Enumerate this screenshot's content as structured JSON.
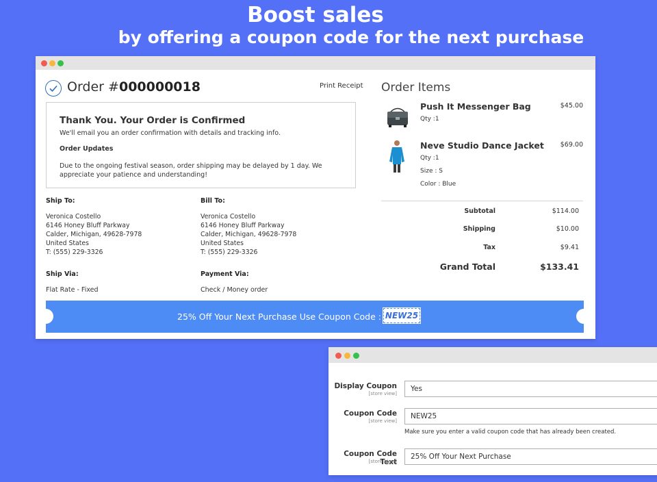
{
  "headline": {
    "title": "Boost sales",
    "subtitle": "by offering a coupon code for the next purchase"
  },
  "order": {
    "title_prefix": "Order #",
    "number": "000000018",
    "print_link": "Print Receipt",
    "confirmation": {
      "title": "Thank You. Your Order is Confirmed",
      "text": "We'll email you an order confirmation with details and tracking info.",
      "updates_label": "Order Updates",
      "updates_text": "Due to the ongoing festival season, order shipping may be delayed by 1 day. We appreciate your patience and understanding!"
    },
    "ship_to": {
      "label": "Ship To:",
      "name": "Veronica Costello",
      "street": "6146 Honey Bluff Parkway",
      "city": "Calder, Michigan, 49628-7978",
      "country": "United States",
      "phone": "T: (555) 229-3326"
    },
    "bill_to": {
      "label": "Bill To:",
      "name": "Veronica Costello",
      "street": "6146 Honey Bluff Parkway",
      "city": "Calder, Michigan, 49628-7978",
      "country": "United States",
      "phone": "T: (555) 229-3326"
    },
    "ship_via": {
      "label": "Ship Via:",
      "value": "Flat Rate - Fixed"
    },
    "payment_via": {
      "label": "Payment Via:",
      "value": "Check / Money order"
    }
  },
  "items": {
    "title": "Order Items",
    "list": [
      {
        "name": "Push It Messenger Bag",
        "price": "$45.00",
        "qty": "Qty :1",
        "icon": "messenger-bag"
      },
      {
        "name": "Neve Studio Dance Jacket",
        "price": "$69.00",
        "qty": "Qty :1",
        "size": "Size : S",
        "color": "Color : Blue",
        "icon": "jacket"
      }
    ]
  },
  "totals": {
    "subtotal_label": "Subtotal",
    "subtotal": "$114.00",
    "shipping_label": "Shipping",
    "shipping": "$10.00",
    "tax_label": "Tax",
    "tax": "$9.41",
    "grand_label": "Grand Total",
    "grand": "$133.41"
  },
  "coupon": {
    "text": "25% Off Your Next Purchase Use Coupon Code :",
    "code": "NEW25",
    "bar_color": "#4e8cf5"
  },
  "settings": {
    "display_coupon": {
      "label": "Display Coupon",
      "scope": "[store view]",
      "value": "Yes"
    },
    "coupon_code": {
      "label": "Coupon Code",
      "scope": "[store view]",
      "value": "NEW25",
      "note": "Make sure you enter a valid coupon code that has already been created."
    },
    "coupon_code_text": {
      "label": "Coupon Code Text",
      "scope": "[store view]",
      "value": "25% Off Your Next Purchase"
    }
  },
  "colors": {
    "background": "#5470f6",
    "accent": "#2f6fb5"
  }
}
